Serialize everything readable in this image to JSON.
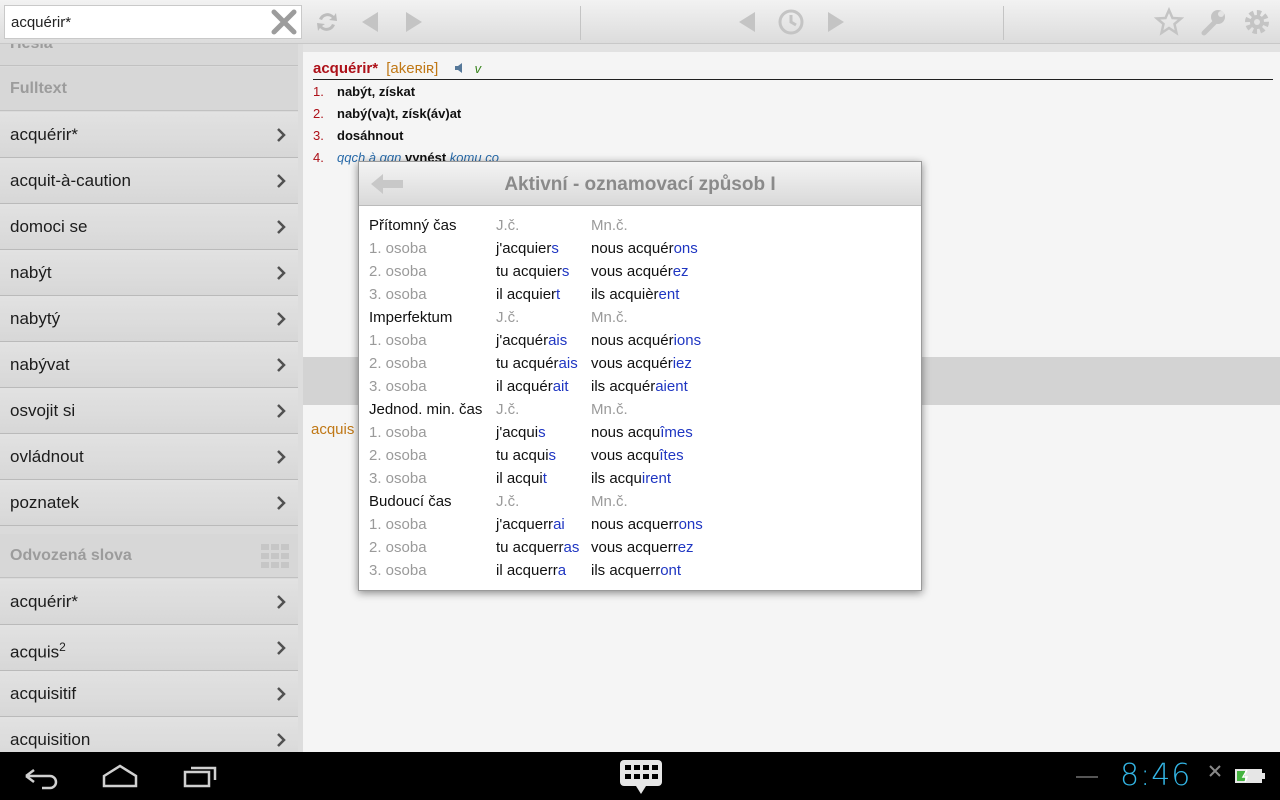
{
  "search": {
    "value": "acquérir*"
  },
  "sidebar": {
    "partial_label": "Hesla",
    "fulltext_header": "Fulltext",
    "fulltext_items": [
      {
        "label": "acquérir*"
      },
      {
        "label": "acquit-à-caution"
      },
      {
        "label": "domoci se"
      },
      {
        "label": "nabýt"
      },
      {
        "label": "nabytý"
      },
      {
        "label": "nabývat"
      },
      {
        "label": "osvojit si"
      },
      {
        "label": "ovládnout"
      },
      {
        "label": "poznatek"
      }
    ],
    "derived_header": "Odvozená slova",
    "derived_items": [
      {
        "label": "acquérir*"
      },
      {
        "label": "acquis",
        "sup": "2"
      },
      {
        "label": "acquisitif"
      },
      {
        "label": "acquisition"
      }
    ]
  },
  "entry": {
    "headword": "acquérir*",
    "pronunciation": "[akeʀiʀ]",
    "pos": "v",
    "senses": [
      {
        "num": "1.",
        "text": "nabýt, získat"
      },
      {
        "num": "2.",
        "text": "nabý(va)t, získ(áv)at"
      },
      {
        "num": "3.",
        "text": "dosáhnout"
      },
      {
        "num": "4.",
        "pre": "qqch à qqn",
        "text": "vynést",
        "post": "komu co"
      }
    ]
  },
  "lower": {
    "word": "acquis"
  },
  "dialog": {
    "title": "Aktivní - oznamovací způsob I",
    "tenses": [
      {
        "name": "Přítomný čas",
        "sg": "J.č.",
        "pl": "Mn.č.",
        "rows": [
          {
            "label": "1. osoba",
            "sg": [
              "j'acquier",
              "s"
            ],
            "pl": [
              "nous acquér",
              "ons"
            ]
          },
          {
            "label": "2. osoba",
            "sg": [
              "tu acquier",
              "s"
            ],
            "pl": [
              "vous acquér",
              "ez"
            ]
          },
          {
            "label": "3. osoba",
            "sg": [
              "il acquier",
              "t"
            ],
            "pl": [
              "ils acquièr",
              "ent"
            ]
          }
        ]
      },
      {
        "name": "Imperfektum",
        "sg": "J.č.",
        "pl": "Mn.č.",
        "rows": [
          {
            "label": "1. osoba",
            "sg": [
              "j'acquér",
              "ais"
            ],
            "pl": [
              "nous acquér",
              "ions"
            ]
          },
          {
            "label": "2. osoba",
            "sg": [
              "tu acquér",
              "ais"
            ],
            "pl": [
              "vous acquér",
              "iez"
            ]
          },
          {
            "label": "3. osoba",
            "sg": [
              "il acquér",
              "ait"
            ],
            "pl": [
              "ils acquér",
              "aient"
            ]
          }
        ]
      },
      {
        "name": "Jednod. min. čas",
        "sg": "J.č.",
        "pl": "Mn.č.",
        "rows": [
          {
            "label": "1. osoba",
            "sg": [
              "j'acqui",
              "s"
            ],
            "pl": [
              "nous acqu",
              "îmes"
            ]
          },
          {
            "label": "2. osoba",
            "sg": [
              "tu acqui",
              "s"
            ],
            "pl": [
              "vous acqu",
              "îtes"
            ]
          },
          {
            "label": "3. osoba",
            "sg": [
              "il acqui",
              "t"
            ],
            "pl": [
              "ils acqu",
              "irent"
            ]
          }
        ]
      },
      {
        "name": "Budoucí čas",
        "sg": "J.č.",
        "pl": "Mn.č.",
        "rows": [
          {
            "label": "1. osoba",
            "sg": [
              "j'acquerr",
              "ai"
            ],
            "pl": [
              "nous acquerr",
              "ons"
            ]
          },
          {
            "label": "2. osoba",
            "sg": [
              "tu acquerr",
              "as"
            ],
            "pl": [
              "vous acquerr",
              "ez"
            ]
          },
          {
            "label": "3. osoba",
            "sg": [
              "il acquerr",
              "a"
            ],
            "pl": [
              "ils acquerr",
              "ont"
            ]
          }
        ]
      }
    ]
  },
  "status": {
    "time": "8:46"
  },
  "colors": {
    "accent": "#33b5e5",
    "headword": "#b5121b",
    "ending": "#1f36c2",
    "pron": "#c87d17"
  }
}
